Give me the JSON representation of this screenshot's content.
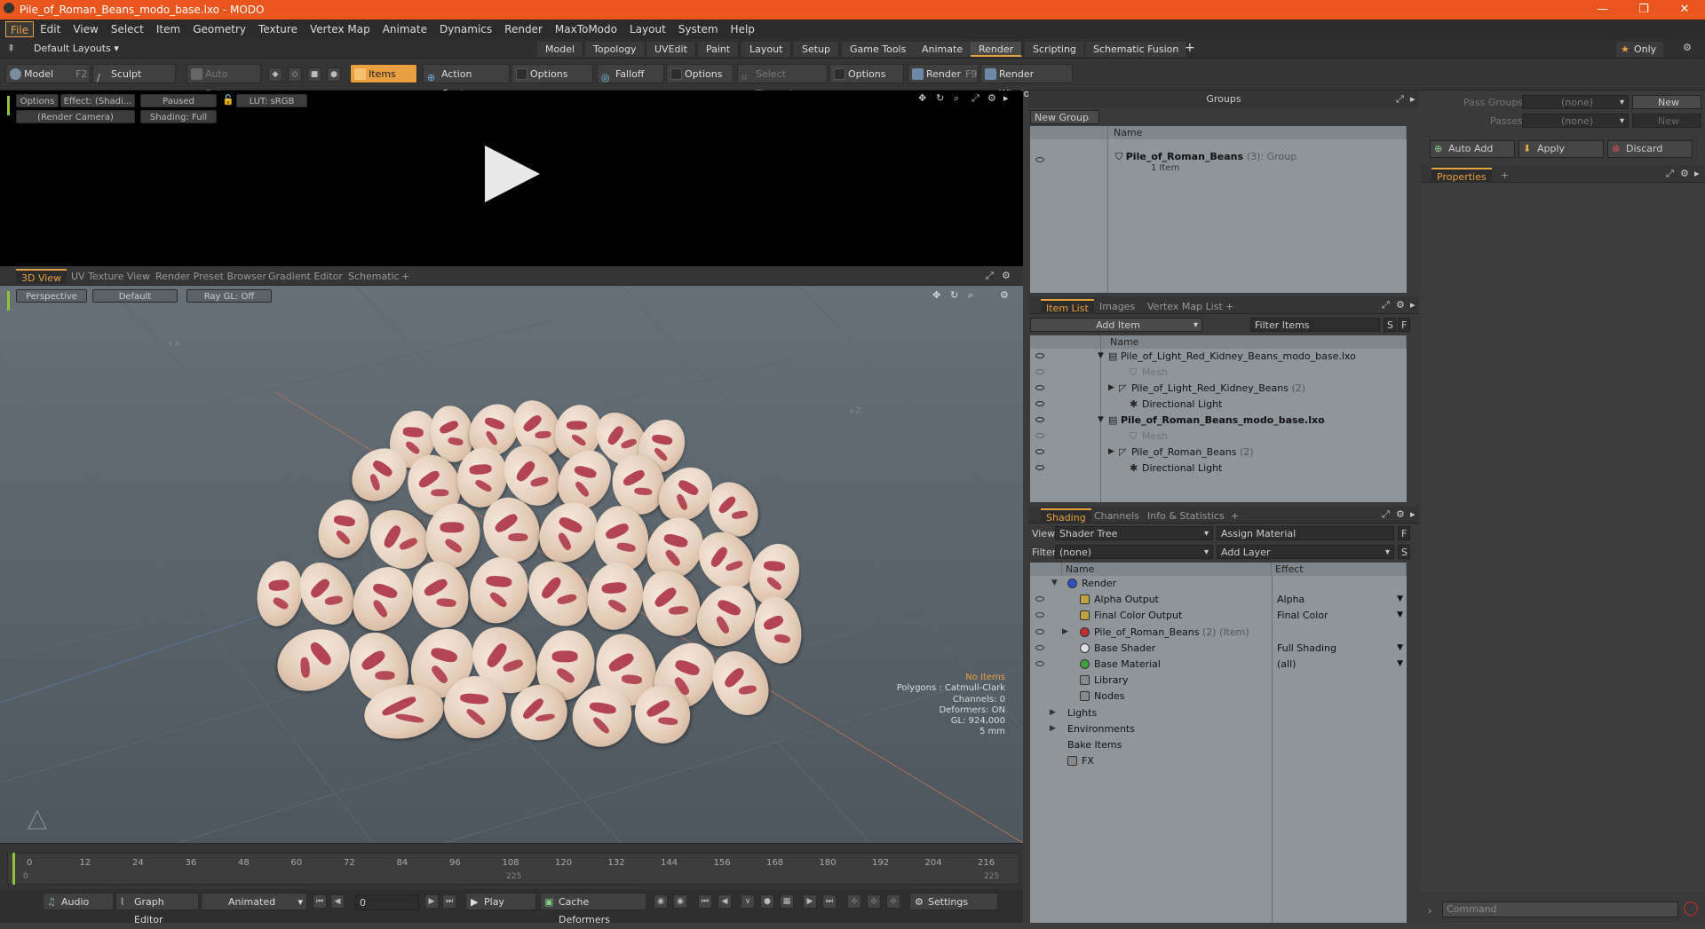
{
  "window": {
    "title": "Pile_of_Roman_Beans_modo_base.lxo - MODO"
  },
  "menu": [
    "File",
    "Edit",
    "View",
    "Select",
    "Item",
    "Geometry",
    "Texture",
    "Vertex Map",
    "Animate",
    "Dynamics",
    "Render",
    "MaxToModo",
    "Layout",
    "System",
    "Help"
  ],
  "layoutbar": {
    "layouts_label": "Default Layouts",
    "tabs": [
      "Model",
      "Topology",
      "UVEdit",
      "Paint",
      "Layout",
      "Setup",
      "Game Tools",
      "Animate",
      "Render",
      "Scripting",
      "Schematic Fusion"
    ],
    "selected_tab": "Render",
    "only_label": "Only"
  },
  "toolbar": {
    "model": "Model",
    "model_key": "F2",
    "sculpt": "Sculpt",
    "auto_select": "Auto Select",
    "items": "Items",
    "action_center": "Action Center",
    "options1": "Options",
    "falloff": "Falloff",
    "options2": "Options",
    "select_through": "Select Through",
    "options3": "Options",
    "render": "Render",
    "render_key": "F9",
    "render_window": "Render Window"
  },
  "render_view": {
    "options": "Options",
    "effect": "Effect: (Shadi...",
    "paused": "Paused",
    "lut": "LUT: sRGB",
    "camera": "(Render Camera)",
    "shading": "Shading: Full"
  },
  "viewport_tabs": [
    "3D View",
    "UV Texture View",
    "Render Preset Browser",
    "Gradient Editor",
    "Schematic"
  ],
  "viewport": {
    "perspective": "Perspective",
    "default": "Default",
    "raygl": "Ray GL: Off",
    "axis_x": "+X",
    "axis_z": "+Z",
    "stats": [
      "No Items",
      "Polygons : Catmull-Clark",
      "Channels: 0",
      "Deformers: ON",
      "GL: 924,000",
      "5 mm"
    ]
  },
  "timeline": {
    "ticks": [
      "0",
      "12",
      "24",
      "36",
      "48",
      "60",
      "72",
      "84",
      "96",
      "108",
      "120",
      "132",
      "144",
      "156",
      "168",
      "180",
      "192",
      "204",
      "216"
    ],
    "sub": [
      "0",
      "225",
      "225"
    ]
  },
  "bottombar": {
    "audio": "Audio",
    "graph_editor": "Graph Editor",
    "animated": "Animated",
    "frame": "0",
    "play": "Play",
    "cache_deformers": "Cache Deformers",
    "settings": "Settings"
  },
  "groups": {
    "title": "Groups",
    "new_group": "New Group",
    "col_name": "Name",
    "item_name": "Pile_of_Roman_Beans",
    "item_count": "(3)",
    "item_type": ": Group",
    "item_sub": "1 Item"
  },
  "item_list": {
    "tabs": [
      "Item List",
      "Images",
      "Vertex Map List"
    ],
    "add_item": "Add Item",
    "filter_items": "Filter Items",
    "col_name": "Name",
    "rows": [
      {
        "label": "Pile_of_Light_Red_Kidney_Beans_modo_base.lxo",
        "indent": 0,
        "bold": false,
        "dim": false
      },
      {
        "label": "Mesh",
        "indent": 2,
        "bold": false,
        "dim": true
      },
      {
        "label": "Pile_of_Light_Red_Kidney_Beans",
        "suffix": "(2)",
        "indent": 1,
        "bold": false,
        "dim": false
      },
      {
        "label": "Directional Light",
        "indent": 2,
        "bold": false,
        "dim": false
      },
      {
        "label": "Pile_of_Roman_Beans_modo_base.lxo",
        "indent": 0,
        "bold": true,
        "dim": false
      },
      {
        "label": "Mesh",
        "indent": 2,
        "bold": false,
        "dim": true
      },
      {
        "label": "Pile_of_Roman_Beans",
        "suffix": "(2)",
        "indent": 1,
        "bold": false,
        "dim": false
      },
      {
        "label": "Directional Light",
        "indent": 2,
        "bold": false,
        "dim": false
      }
    ]
  },
  "shading": {
    "tabs": [
      "Shading",
      "Channels",
      "Info & Statistics"
    ],
    "view_label": "View",
    "view_value": "Shader Tree",
    "assign_material": "Assign Material",
    "filter_label": "Filter",
    "filter_value": "(none)",
    "add_layer": "Add Layer",
    "col_name": "Name",
    "col_effect": "Effect",
    "rows": [
      {
        "label": "Render",
        "effect": "",
        "indent": 0
      },
      {
        "label": "Alpha Output",
        "effect": "Alpha",
        "indent": 1
      },
      {
        "label": "Final Color Output",
        "effect": "Final Color",
        "indent": 1
      },
      {
        "label": "Pile_of_Roman_Beans",
        "suffix": "(2) (Item)",
        "effect": "",
        "indent": 1
      },
      {
        "label": "Base Shader",
        "effect": "Full Shading",
        "indent": 1
      },
      {
        "label": "Base Material",
        "effect": "(all)",
        "indent": 1
      },
      {
        "label": "Library",
        "effect": "",
        "indent": 1
      },
      {
        "label": "Nodes",
        "effect": "",
        "indent": 1
      },
      {
        "label": "Lights",
        "effect": "",
        "indent": 0
      },
      {
        "label": "Environments",
        "effect": "",
        "indent": 0
      },
      {
        "label": "Bake Items",
        "effect": "",
        "indent": 0
      },
      {
        "label": "FX",
        "effect": "",
        "indent": 0
      }
    ]
  },
  "passes": {
    "pass_groups": "Pass Groups",
    "passes": "Passes",
    "none1": "(none)",
    "none2": "(none)",
    "new1": "New",
    "new2": "New",
    "auto_add": "Auto Add",
    "apply": "Apply",
    "discard": "Discard",
    "properties": "Properties"
  },
  "command": {
    "placeholder": "Command"
  }
}
